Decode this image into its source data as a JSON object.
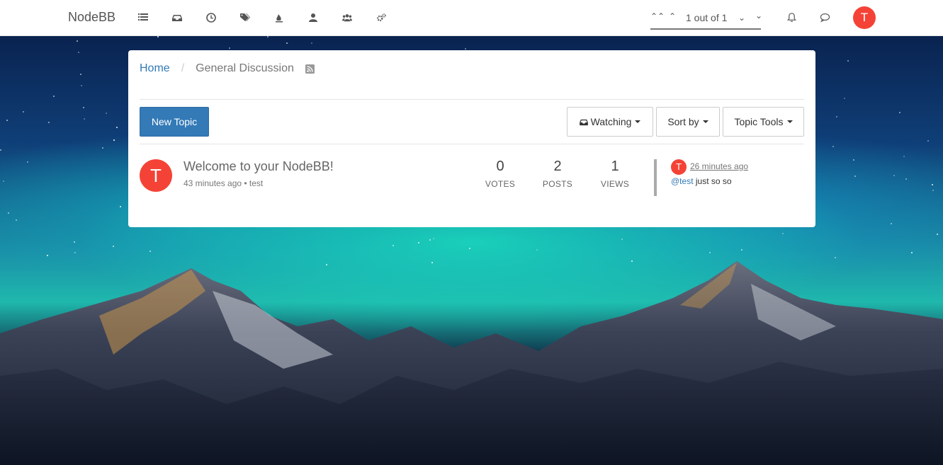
{
  "brand": "NodeBB",
  "nav_icons": [
    "list-icon",
    "inbox-icon",
    "clock-icon",
    "tags-icon",
    "fire-icon",
    "user-icon",
    "users-icon",
    "cogs-icon"
  ],
  "pager": {
    "text": "1 out of 1"
  },
  "user": {
    "initial": "T",
    "color": "#f44336"
  },
  "breadcrumb": {
    "home": "Home",
    "current": "General Discussion"
  },
  "toolbar": {
    "new_topic": "New Topic",
    "watching": "Watching",
    "sort_by": "Sort by",
    "topic_tools": "Topic Tools"
  },
  "topic": {
    "avatar_initial": "T",
    "title": "Welcome to your NodeBB!",
    "meta": "43 minutes ago • test",
    "stats": {
      "votes": "0",
      "votes_label": "VOTES",
      "posts": "2",
      "posts_label": "POSTS",
      "views": "1",
      "views_label": "VIEWS"
    },
    "teaser": {
      "avatar_initial": "T",
      "time": "26 minutes ago",
      "mention": "@test",
      "text": " just so so"
    }
  },
  "colors": {
    "accent": "#337ab7",
    "avatar": "#f44336"
  }
}
